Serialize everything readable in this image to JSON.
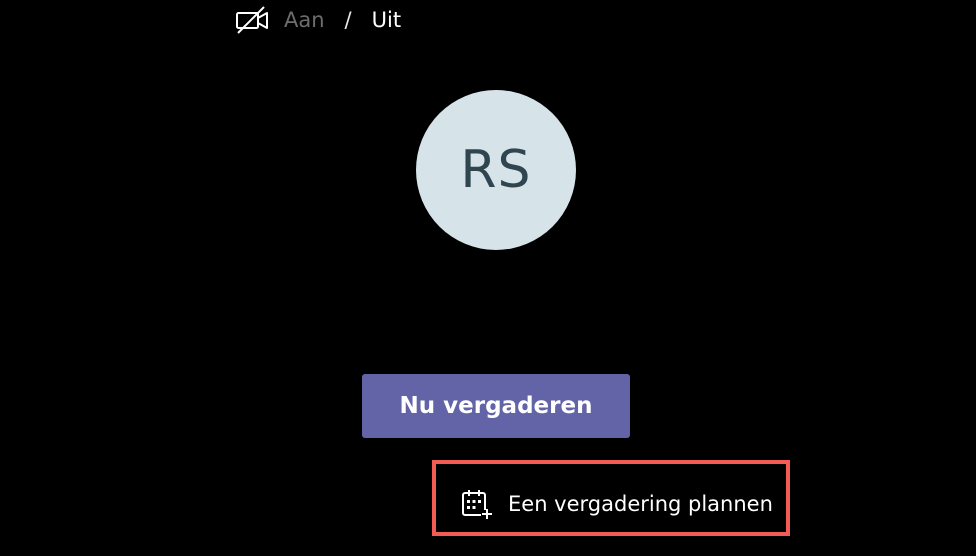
{
  "avatar": {
    "initials": "RS",
    "bg_color": "#d6e4ea",
    "text_color": "#2f4650"
  },
  "meet_now_button": {
    "label": "Nu vergaderen",
    "color": "#6264a7"
  },
  "camera_toggle": {
    "icon": "camera-off-icon",
    "on_label": "Aan",
    "separator": "/",
    "off_label": "Uit",
    "selected": "Uit"
  },
  "schedule_meeting": {
    "icon": "calendar-add-icon",
    "label": "Een vergadering plannen",
    "highlight_color": "#f25c54"
  }
}
